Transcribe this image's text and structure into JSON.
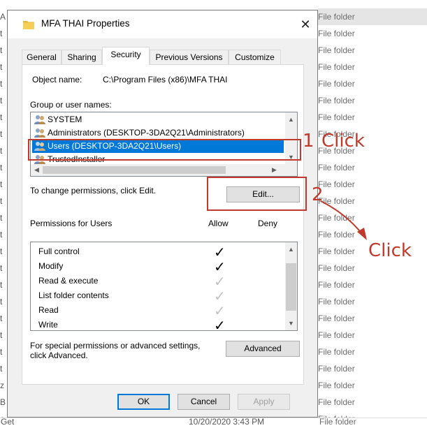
{
  "background": {
    "rows": [
      "File folder",
      "File folder",
      "File folder",
      "File folder",
      "File folder",
      "File folder",
      "File folder",
      "File folder",
      "File folder",
      "File folder",
      "File folder",
      "File folder",
      "File folder",
      "File folder",
      "File folder",
      "File folder",
      "File folder",
      "File folder",
      "File folder",
      "File folder",
      "File folder",
      "File folder",
      "File folder",
      "File folder",
      "File folder"
    ],
    "left_letters": [
      "A",
      "t",
      "t",
      "t",
      "t",
      "t",
      "t",
      "t",
      "t",
      "t",
      "t",
      "t",
      "t",
      "t",
      "t",
      "t",
      "t",
      "t",
      "t",
      "t",
      "t",
      "t",
      "z",
      "B",
      "e"
    ],
    "bottom_left": "Get",
    "bottom_date": "10/20/2020 3:43 PM",
    "bottom_type": "File folder"
  },
  "dialog": {
    "title": "MFA THAI Properties",
    "close": "✕",
    "tabs": [
      "General",
      "Sharing",
      "Security",
      "Previous Versions",
      "Customize"
    ],
    "object_name_label": "Object name:",
    "object_name_value": "C:\\Program Files (x86)\\MFA THAI",
    "group_label": "Group or user names:",
    "groups": [
      "SYSTEM",
      "Administrators (DESKTOP-3DA2Q21\\Administrators)",
      "Users (DESKTOP-3DA2Q21\\Users)",
      "TrustedInstaller"
    ],
    "change_text": "To change permissions, click Edit.",
    "edit_button": "Edit...",
    "permissions_label": "Permissions for Users",
    "allow_label": "Allow",
    "deny_label": "Deny",
    "permissions": [
      "Full control",
      "Modify",
      "Read & execute",
      "List folder contents",
      "Read",
      "Write"
    ],
    "permission_allow_state": [
      "explicit",
      "explicit",
      "inherited",
      "inherited",
      "inherited",
      "explicit"
    ],
    "special_text_1": "For special permissions or advanced settings,",
    "special_text_2": "click Advanced.",
    "advanced_button": "Advanced",
    "ok_button": "OK",
    "cancel_button": "Cancel",
    "apply_button": "Apply"
  },
  "annotations": {
    "step1": "1",
    "step1_label": "Click",
    "step2": "2",
    "step2_label": "Click",
    "color": "#c0392b"
  },
  "icons": {
    "folder": "folder-icon",
    "user_group": "user-group-icon",
    "check": "check-icon"
  }
}
